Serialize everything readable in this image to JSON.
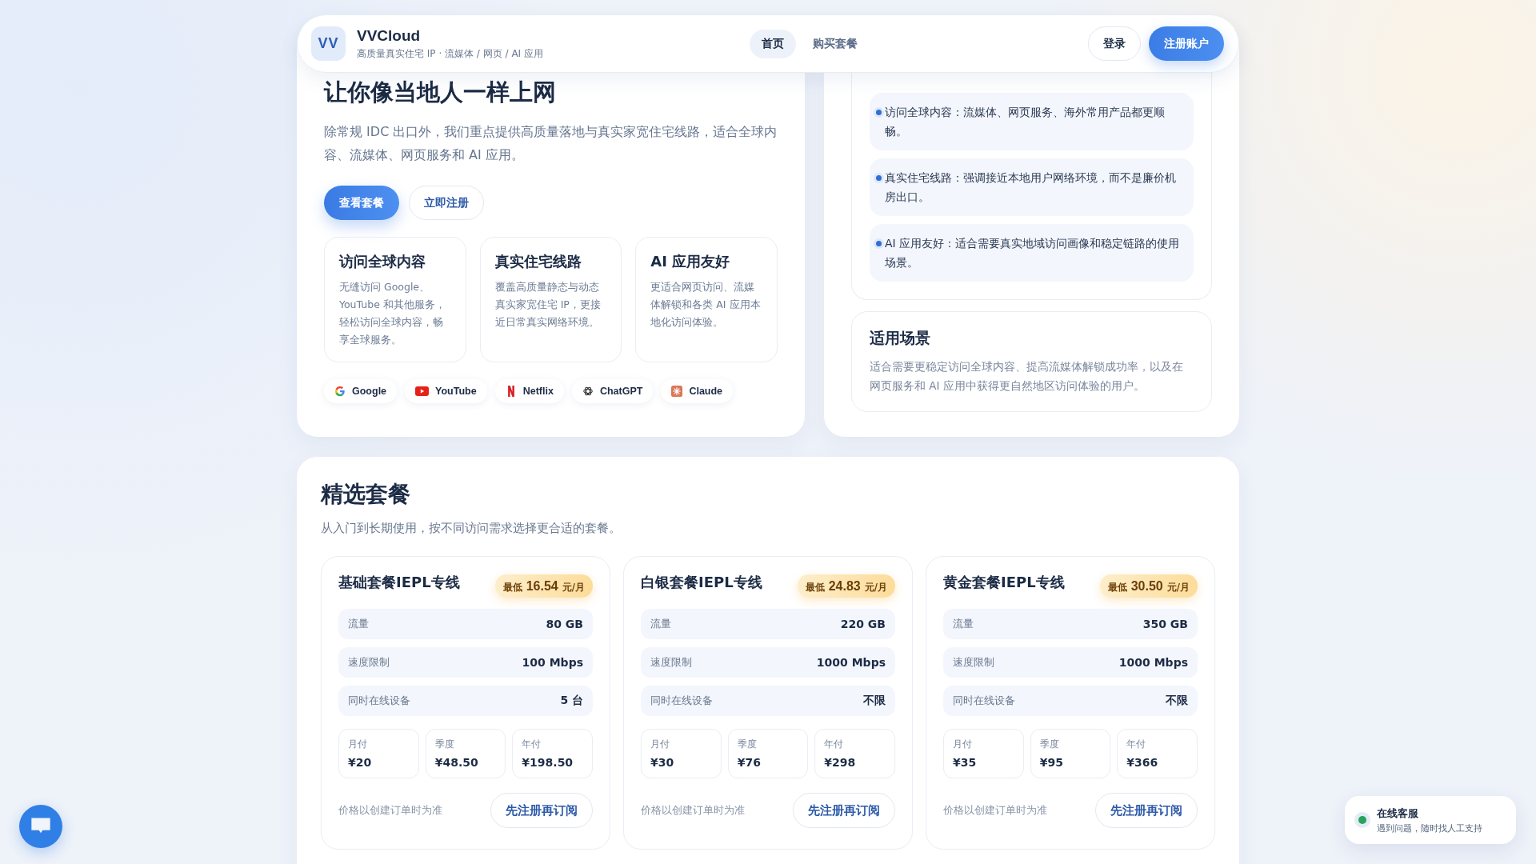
{
  "header": {
    "logo": "VV",
    "brand": "VVCloud",
    "tagline": "高质量真实住宅 IP · 流媒体 / 网页 / AI 应用",
    "nav": [
      {
        "label": "首页",
        "selected": true
      },
      {
        "label": "购买套餐",
        "selected": false
      }
    ],
    "login": "登录",
    "signup": "注册账户"
  },
  "hero": {
    "title": "让你像当地人一样上网",
    "text": "除常规 IDC 出口外，我们重点提供高质量落地与真实家宽住宅线路，适合全球内容、流媒体、网页服务和 AI 应用。",
    "buttons": [
      {
        "label": "查看套餐",
        "kind": "primary"
      },
      {
        "label": "立即注册",
        "kind": "outline"
      }
    ],
    "features": [
      {
        "title": "访问全球内容",
        "text": "无缝访问 Google、YouTube 和其他服务，轻松访问全球内容，畅享全球服务。"
      },
      {
        "title": "真实住宅线路",
        "text": "覆盖高质量静态与动态真实家宽住宅 IP，更接近日常真实网络环境。"
      },
      {
        "title": "AI 应用友好",
        "text": "更适合网页访问、流媒体解锁和各类 AI 应用本地化访问体验。"
      }
    ],
    "services": [
      {
        "name": "Google",
        "kind": "google"
      },
      {
        "name": "YouTube",
        "kind": "youtube"
      },
      {
        "name": "Netflix",
        "kind": "netflix"
      },
      {
        "name": "ChatGPT",
        "kind": "chatgpt"
      },
      {
        "name": "Claude",
        "kind": "claude"
      }
    ]
  },
  "why": {
    "points": [
      "访问全球内容：流媒体、网页服务、海外常用产品都更顺畅。",
      "真实住宅线路：强调接近本地用户网络环境，而不是廉价机房出口。",
      "AI 应用友好：适合需要真实地域访问画像和稳定链路的使用场景。"
    ]
  },
  "scenario": {
    "title": "适用场景",
    "text": "适合需要更稳定访问全球内容、提高流媒体解锁成功率，以及在网页服务和 AI 应用中获得更自然地区访问体验的用户。"
  },
  "plans": {
    "title": "精选套餐",
    "subtitle": "从入门到长期使用，按不同访问需求选择更合适的套餐。",
    "items": [
      {
        "name": "基础套餐IEPL专线",
        "badge_prefix": "最低",
        "badge_price": "16.54",
        "badge_unit": "元/月",
        "specs": [
          {
            "label": "流量",
            "value": "80 GB"
          },
          {
            "label": "速度限制",
            "value": "100 Mbps"
          },
          {
            "label": "同时在线设备",
            "value": "5 台"
          }
        ],
        "prices": [
          {
            "label": "月付",
            "value": "¥20"
          },
          {
            "label": "季度",
            "value": "¥48.50"
          },
          {
            "label": "年付",
            "value": "¥198.50"
          }
        ],
        "note": "价格以创建订单时为准",
        "button": "先注册再订阅"
      },
      {
        "name": "白银套餐IEPL专线",
        "badge_prefix": "最低",
        "badge_price": "24.83",
        "badge_unit": "元/月",
        "specs": [
          {
            "label": "流量",
            "value": "220 GB"
          },
          {
            "label": "速度限制",
            "value": "1000 Mbps"
          },
          {
            "label": "同时在线设备",
            "value": "不限"
          }
        ],
        "prices": [
          {
            "label": "月付",
            "value": "¥30"
          },
          {
            "label": "季度",
            "value": "¥76"
          },
          {
            "label": "年付",
            "value": "¥298"
          }
        ],
        "note": "价格以创建订单时为准",
        "button": "先注册再订阅"
      },
      {
        "name": "黄金套餐IEPL专线",
        "badge_prefix": "最低",
        "badge_price": "30.50",
        "badge_unit": "元/月",
        "specs": [
          {
            "label": "流量",
            "value": "350 GB"
          },
          {
            "label": "速度限制",
            "value": "1000 Mbps"
          },
          {
            "label": "同时在线设备",
            "value": "不限"
          }
        ],
        "prices": [
          {
            "label": "月付",
            "value": "¥35"
          },
          {
            "label": "季度",
            "value": "¥95"
          },
          {
            "label": "年付",
            "value": "¥366"
          }
        ],
        "note": "价格以创建订单时为准",
        "button": "先注册再订阅"
      }
    ]
  },
  "support": {
    "title": "在线客服",
    "text": "遇到问题，随时找人工支持",
    "online": true
  }
}
